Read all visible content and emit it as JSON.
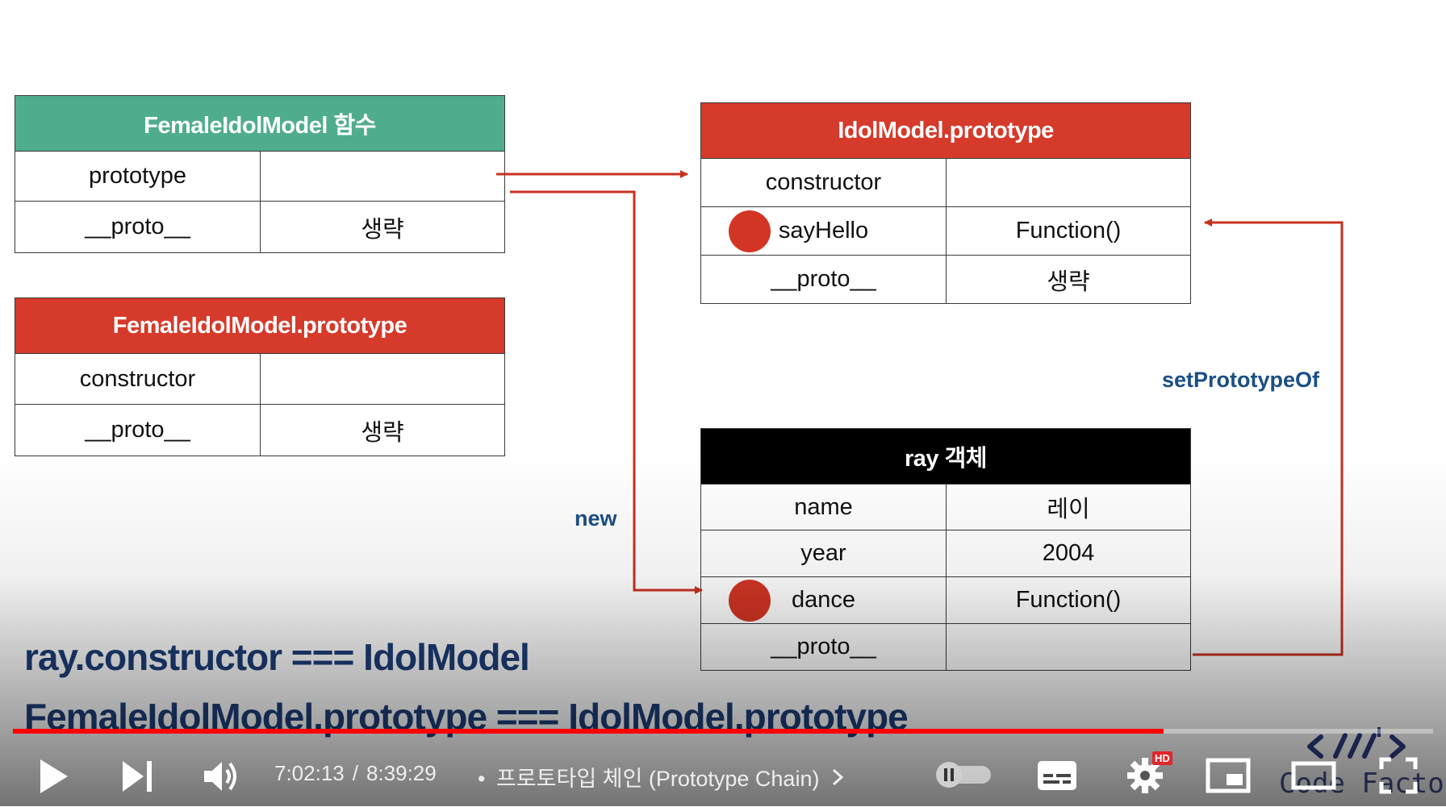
{
  "slide": {
    "female_func": {
      "title": "FemaleIdolModel 함수",
      "rows": [
        {
          "key": "prototype",
          "value": ""
        },
        {
          "key": "__proto__",
          "value": "생략"
        }
      ]
    },
    "female_proto": {
      "title": "FemaleIdolModel.prototype",
      "rows": [
        {
          "key": "constructor",
          "value": ""
        },
        {
          "key": "__proto__",
          "value": "생략"
        }
      ]
    },
    "idol_proto": {
      "title": "IdolModel.prototype",
      "rows": [
        {
          "key": "constructor",
          "value": ""
        },
        {
          "key": "sayHello",
          "value": "Function()"
        },
        {
          "key": "__proto__",
          "value": "생략"
        }
      ]
    },
    "ray": {
      "title": "ray 객체",
      "rows": [
        {
          "key": "name",
          "value": "레이"
        },
        {
          "key": "year",
          "value": "2004"
        },
        {
          "key": "dance",
          "value": "Function()"
        },
        {
          "key": "__proto__",
          "value": ""
        }
      ]
    },
    "new_label": "new",
    "setproto_label": "setPrototypeOf",
    "code_line1": "ray.constructor === IdolModel",
    "code_line2": "FemaleIdolModel.prototype === IdolModel.prototype",
    "watermark": "Code Factory",
    "colors": {
      "green": "#4fad8e",
      "red": "#d63a2a",
      "arrow": "#c8301f",
      "blue_text": "#1d3e78"
    }
  },
  "player": {
    "current_time": "7:02:13",
    "duration": "8:39:29",
    "separator": "/",
    "chapter_bullet": "•",
    "chapter_title": "프로토타입 체인 (Prototype Chain)",
    "progress_fraction": 0.81,
    "hd_badge": "HD",
    "icons": [
      "play-icon",
      "next-icon",
      "volume-icon",
      "autoplay-toggle",
      "subtitles-icon",
      "settings-icon",
      "miniplayer-icon",
      "theater-icon",
      "fullscreen-icon"
    ]
  }
}
